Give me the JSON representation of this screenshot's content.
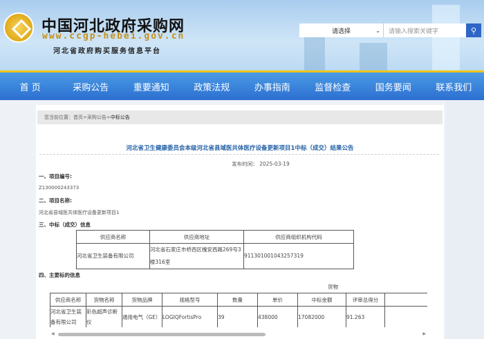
{
  "header": {
    "site_title": "中国河北政府采购网",
    "site_url": "www.ccgp-hebei.gov.cn",
    "site_subtitle": "河北省政府购买服务信息平台",
    "search": {
      "select_value": "请选择",
      "placeholder": "请输入搜索关键字"
    }
  },
  "nav": [
    "首 页",
    "采购公告",
    "重要通知",
    "政策法规",
    "办事指南",
    "监督检查",
    "国务要闻",
    "联系我们"
  ],
  "breadcrumb": {
    "label": "您当前位置：",
    "items": [
      "首页",
      ">",
      "采购公告",
      ">"
    ],
    "current": "中标公告"
  },
  "article": {
    "title": "河北省卫生健康委员会本级河北省县域医共体医疗设备更新项目1中标（成交）结果公告",
    "date": "发布时间： 2025-03-19",
    "s1_heading": "一、项目编号:",
    "s1_value": "Z130000243373",
    "s2_heading": "二、项目名称:",
    "s2_value": "河北省县域医共体医疗设备更新项目1",
    "s3_heading": "三、中标（成交）信息",
    "supplier_table": {
      "headers": [
        "供应商名称",
        "供应商地址",
        "供应商组织机构代码"
      ],
      "rows": [
        [
          "河北省卫生装备有限公司",
          "河北省石家庄市桥西区槐安西路269号3楼316室",
          "911301001043257319"
        ]
      ]
    },
    "s4_heading": "四、主要标的信息",
    "goods_label": "货物",
    "goods_table": {
      "headers": [
        "供应商名称",
        "货物名称",
        "货物品牌",
        "规格型号",
        "数量",
        "单价",
        "中标金额",
        "评审总得分",
        ""
      ],
      "rows": [
        [
          "河北省卫生装备有限公司",
          "彩色超声诊断仪",
          "通用电气（GE）",
          "LOGIQFortisPro",
          "39",
          "438000",
          "17082000",
          "91.263",
          ""
        ]
      ]
    }
  }
}
